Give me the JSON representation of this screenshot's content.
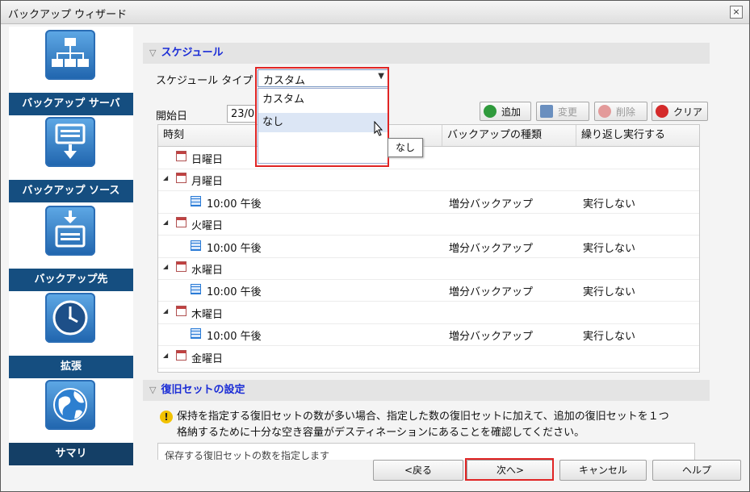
{
  "window": {
    "title": "バックアップ ウィザード",
    "close_glyph": "×"
  },
  "sidebar": {
    "items": [
      {
        "label": "バックアップ サーバ",
        "icon": "network-server-icon"
      },
      {
        "label": "バックアップ ソース",
        "icon": "drive-download-icon"
      },
      {
        "label": "バックアップ先",
        "icon": "drive-destination-icon"
      },
      {
        "label": "拡張",
        "icon": "clock-icon"
      },
      {
        "label": "サマリ",
        "icon": "globe-icon"
      }
    ]
  },
  "schedule": {
    "section_title": "スケジュール",
    "type_label": "スケジュール タイプ",
    "type_value": "カスタム",
    "dropdown_options": [
      "カスタム",
      "なし"
    ],
    "tooltip": "なし",
    "start_date_label": "開始日",
    "start_date_value": "23/09",
    "toolbar": {
      "add": "追加",
      "edit": "変更",
      "delete": "削除",
      "clear": "クリア"
    },
    "columns": [
      "時刻",
      "バックアップの種類",
      "繰り返し実行する"
    ],
    "rows": [
      {
        "kind": "day",
        "label": "日曜日",
        "expanded": false
      },
      {
        "kind": "day",
        "label": "月曜日",
        "expanded": true
      },
      {
        "kind": "time",
        "label": "10:00 午後",
        "type": "増分バックアップ",
        "repeat": "実行しない"
      },
      {
        "kind": "day",
        "label": "火曜日",
        "expanded": true
      },
      {
        "kind": "time",
        "label": "10:00 午後",
        "type": "増分バックアップ",
        "repeat": "実行しない"
      },
      {
        "kind": "day",
        "label": "水曜日",
        "expanded": true
      },
      {
        "kind": "time",
        "label": "10:00 午後",
        "type": "増分バックアップ",
        "repeat": "実行しない"
      },
      {
        "kind": "day",
        "label": "木曜日",
        "expanded": true
      },
      {
        "kind": "time",
        "label": "10:00 午後",
        "type": "増分バックアップ",
        "repeat": "実行しない"
      },
      {
        "kind": "day",
        "label": "金曜日",
        "expanded": true
      }
    ]
  },
  "recovery": {
    "section_title": "復旧セットの設定",
    "warning_line1": "保持を指定する復旧セットの数が多い場合、指定した数の復旧セットに加えて、追加の復旧セットを１つ",
    "warning_line2": "格納するために十分な空き容量がデスティネーションにあることを確認してください。",
    "partial_text": "保存する復旧セットの数を指定します"
  },
  "footer": {
    "back": "<戻る",
    "next": "次へ>",
    "cancel": "キャンセル",
    "help": "ヘルプ"
  },
  "colors": {
    "sidebar_label_bg": "#154e80",
    "section_title": "#1a2cd6",
    "highlight": "#e02424"
  }
}
